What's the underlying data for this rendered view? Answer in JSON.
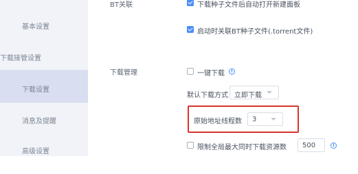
{
  "sidebar": {
    "items": [
      {
        "label": "基本设置"
      },
      {
        "label": "下载接管设置"
      },
      {
        "label": "下载设置"
      },
      {
        "label": "消息及提醒"
      },
      {
        "label": "高级设置"
      }
    ]
  },
  "bt": {
    "section_label": "BT关联",
    "auto_open_label": "下载种子文件后自动打开新建面板",
    "associate_label": "启动时关联BT种子文件(.torrent文件)"
  },
  "download_mgmt": {
    "section_label": "下载管理",
    "one_click_label": "一键下载",
    "default_mode_label": "默认下载方式",
    "default_mode_value": "立即下载",
    "threads_label": "原始地址线程数",
    "threads_value": "3",
    "limit_label": "限制全局最大同时下载资源数",
    "limit_value": "500"
  },
  "colors": {
    "accent": "#4b8df8",
    "highlight": "#d9342b",
    "sidebar_bg": "#f1f3f8",
    "sidebar_active_bg": "#d9dff0"
  }
}
